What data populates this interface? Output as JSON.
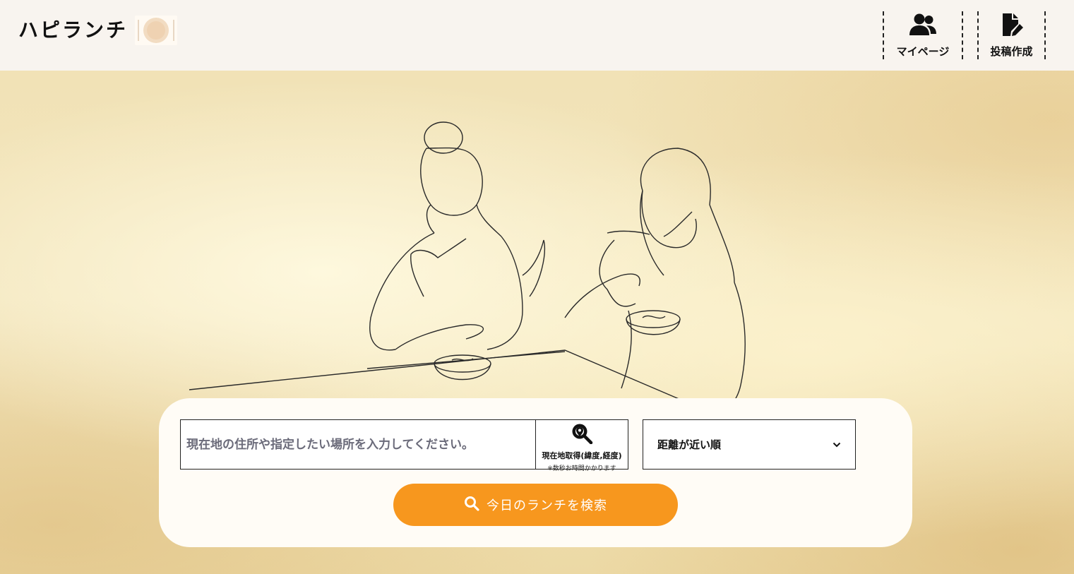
{
  "header": {
    "logo_text": "ハピランチ",
    "logo_icon": "plate-icon",
    "nav": [
      {
        "label": "マイページ",
        "icon": "users-icon"
      },
      {
        "label": "投稿作成",
        "icon": "file-edit-icon"
      }
    ]
  },
  "stray_dot": ".",
  "search": {
    "placeholder": "現在地の住所や指定したい場所を入力してください。",
    "geo_button_label": "現在地取得(緯度,経度)",
    "geo_button_note": "※数秒お時間かかります",
    "geo_icon": "map-pin-search-icon",
    "sort_selected": "距離が近い順",
    "submit_label": "今日のランチを検索",
    "submit_icon": "search-icon"
  },
  "colors": {
    "accent": "#f7971e",
    "header_bg": "#f8f4ef",
    "card_bg": "#fffcf6"
  }
}
